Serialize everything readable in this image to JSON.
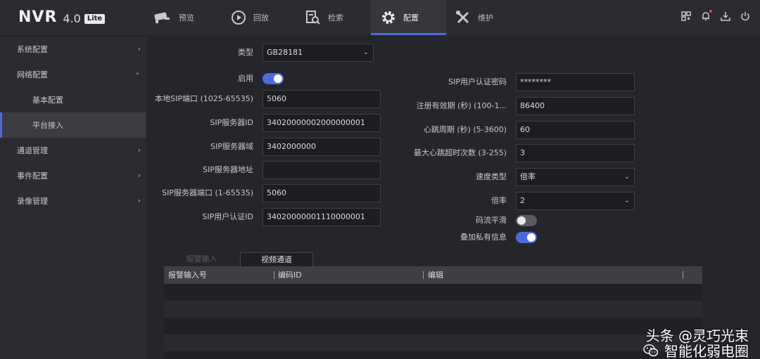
{
  "logo": {
    "name": "NVR",
    "version": "4.0",
    "edition": "Lite"
  },
  "nav": [
    {
      "label": "预览",
      "icon": "camera-icon"
    },
    {
      "label": "回放",
      "icon": "playback-icon"
    },
    {
      "label": "检索",
      "icon": "search-doc-icon"
    },
    {
      "label": "配置",
      "icon": "gear-icon",
      "active": true
    },
    {
      "label": "维护",
      "icon": "tools-icon"
    }
  ],
  "top_icons": [
    "qr-code-icon",
    "bell-icon",
    "download-icon",
    "power-icon"
  ],
  "sidebar": {
    "items": [
      {
        "label": "系统配置",
        "chevron": "›"
      },
      {
        "label": "网络配置",
        "chevron": "⌄"
      },
      {
        "label": "基本配置"
      },
      {
        "label": "平台接入",
        "active": true
      },
      {
        "label": "通道管理",
        "chevron": "›"
      },
      {
        "label": "事件配置",
        "chevron": "›"
      },
      {
        "label": "录像管理",
        "chevron": "›"
      }
    ]
  },
  "form": {
    "type_label": "类型",
    "type_value": "GB28181",
    "enable_label": "启用",
    "enable_on": true,
    "local_port_label": "本地SIP端口 (1025-65535)",
    "local_port_value": "5060",
    "server_id_label": "SIP服务器ID",
    "server_id_value": "34020000002000000001",
    "server_domain_label": "SIP服务器域",
    "server_domain_value": "3402000000",
    "server_addr_label": "SIP服务器地址",
    "server_addr_value": "",
    "server_port_label": "SIP服务器端口 (1-65535)",
    "server_port_value": "5060",
    "auth_id_label": "SIP用户认证ID",
    "auth_id_value": "34020000001110000001",
    "password_label": "SIP用户认证密码",
    "password_value": "********",
    "expire_label": "注册有效期 (秒) (100-1...",
    "expire_value": "86400",
    "heartbeat_label": "心跳周期 (秒) (5-3600)",
    "heartbeat_value": "60",
    "max_timeout_label": "最大心跳超时次数 (3-255)",
    "max_timeout_value": "3",
    "speed_type_label": "速度类型",
    "speed_type_value": "倍率",
    "rate_label": "倍率",
    "rate_value": "2",
    "smooth_label": "码流平滑",
    "smooth_on": false,
    "private_info_label": "叠加私有信息",
    "private_info_on": true
  },
  "tabs": [
    {
      "label": "报警输入",
      "active": false
    },
    {
      "label": "视频通道",
      "active": true
    }
  ],
  "table": {
    "headers": [
      "报警输入号",
      "编码ID",
      "编辑"
    ],
    "rows": []
  },
  "watermark": {
    "line1": "头条 @灵巧光束",
    "line2": "智能化弱电圈"
  },
  "colors": {
    "accent": "#4f6bdb",
    "background": "#25262b",
    "panel": "#2b2c31"
  }
}
